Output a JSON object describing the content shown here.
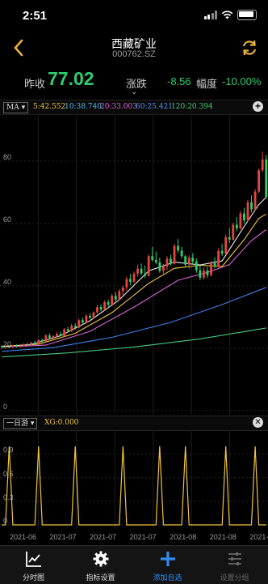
{
  "status": {
    "time": "2:51"
  },
  "header": {
    "name": "西藏矿业",
    "code": "000762.SZ"
  },
  "quote": {
    "prev_close_label": "昨收",
    "prev_close": "77.02",
    "change_label": "涨跌",
    "change": "-8.56",
    "pct_label": "幅度",
    "pct": "-10.00%"
  },
  "ma_bar": {
    "selector": "MA",
    "ma5": "5:42.552",
    "ma10": "10:38.740",
    "ma20": "20:33.003",
    "ma60": "60:25.421",
    "ma120": "120:20.394"
  },
  "xg_bar": {
    "selector": "一日游",
    "value": "XG:0.000"
  },
  "tabs": [
    {
      "label": "分时图",
      "icon": "line-chart-icon"
    },
    {
      "label": "指标设置",
      "icon": "gear-icon"
    },
    {
      "label": "添加自选",
      "icon": "plus-icon"
    },
    {
      "label": "设置分组",
      "icon": "sliders-icon"
    }
  ],
  "colors": {
    "up": "#e8443a",
    "down": "#2fcd72",
    "ma5": "#e6e6e6",
    "ma10": "#f0c53a",
    "ma20": "#d865d2",
    "ma60": "#3f7fe6",
    "ma120": "#46c87a",
    "accent": "#e8b339"
  },
  "chart_data": [
    {
      "type": "candlestick",
      "y_ticks": [
        "80",
        "60",
        "40",
        "20",
        "0"
      ],
      "ylim": [
        0,
        95
      ],
      "x_tick_labels": [
        "2021-06",
        "2021-07",
        "2021-07",
        "2021-07",
        "2021-08",
        "2021-08",
        "2021-0"
      ],
      "candles": [
        [
          20.6,
          21.0,
          19.9,
          20.3
        ],
        [
          20.3,
          20.8,
          19.8,
          20.5
        ],
        [
          20.5,
          20.9,
          20.1,
          20.4
        ],
        [
          20.4,
          21.1,
          20.0,
          20.9
        ],
        [
          20.9,
          21.2,
          20.3,
          20.6
        ],
        [
          20.6,
          21.0,
          20.2,
          20.8
        ],
        [
          20.8,
          21.6,
          20.5,
          21.3
        ],
        [
          21.3,
          21.8,
          20.9,
          21.1
        ],
        [
          21.1,
          22.0,
          20.8,
          21.8
        ],
        [
          21.8,
          22.4,
          21.2,
          21.4
        ],
        [
          21.4,
          22.9,
          21.1,
          22.6
        ],
        [
          22.6,
          23.2,
          21.9,
          22.2
        ],
        [
          22.2,
          24.5,
          22.0,
          24.1
        ],
        [
          24.1,
          24.8,
          23.0,
          23.3
        ],
        [
          23.3,
          24.2,
          22.8,
          23.9
        ],
        [
          23.9,
          25.1,
          23.4,
          24.6
        ],
        [
          24.6,
          25.2,
          23.8,
          24.0
        ],
        [
          24.0,
          26.5,
          23.8,
          26.1
        ],
        [
          26.1,
          26.9,
          25.1,
          25.5
        ],
        [
          25.5,
          27.8,
          25.2,
          27.2
        ],
        [
          27.2,
          28.0,
          26.0,
          26.6
        ],
        [
          26.6,
          29.5,
          26.4,
          29.0
        ],
        [
          29.0,
          29.8,
          27.9,
          28.2
        ],
        [
          28.2,
          30.9,
          27.9,
          30.4
        ],
        [
          30.4,
          31.2,
          29.3,
          29.8
        ],
        [
          29.8,
          31.8,
          29.4,
          31.5
        ],
        [
          31.5,
          33.9,
          31.0,
          33.2
        ],
        [
          33.2,
          34.1,
          31.8,
          32.4
        ],
        [
          32.4,
          35.3,
          32.1,
          34.8
        ],
        [
          34.8,
          35.6,
          33.2,
          33.9
        ],
        [
          33.9,
          37.4,
          33.5,
          36.8
        ],
        [
          36.8,
          38.0,
          35.0,
          35.6
        ],
        [
          35.6,
          39.0,
          35.3,
          38.3
        ],
        [
          38.3,
          40.1,
          36.8,
          39.5
        ],
        [
          39.5,
          43.0,
          38.5,
          42.2
        ],
        [
          42.2,
          43.8,
          40.2,
          41.3
        ],
        [
          41.3,
          44.6,
          40.9,
          43.9
        ],
        [
          43.9,
          46.8,
          43.0,
          45.5
        ],
        [
          45.5,
          47.2,
          43.4,
          44.0
        ],
        [
          44.0,
          46.5,
          42.5,
          43.2
        ],
        [
          43.2,
          50.1,
          43.0,
          49.5
        ],
        [
          49.5,
          52.5,
          47.8,
          48.3
        ],
        [
          48.3,
          51.0,
          46.9,
          47.5
        ],
        [
          47.5,
          49.0,
          44.2,
          44.8
        ],
        [
          44.8,
          47.0,
          43.5,
          46.2
        ],
        [
          46.2,
          49.5,
          45.0,
          48.7
        ],
        [
          48.7,
          50.0,
          46.5,
          47.1
        ],
        [
          47.1,
          53.5,
          46.8,
          52.8
        ],
        [
          52.8,
          55.0,
          50.5,
          51.3
        ],
        [
          51.3,
          52.5,
          48.8,
          49.5
        ],
        [
          49.5,
          50.0,
          46.0,
          46.8
        ],
        [
          46.8,
          49.8,
          45.5,
          49.0
        ],
        [
          49.0,
          50.5,
          47.0,
          47.8
        ],
        [
          47.8,
          48.8,
          44.2,
          45.0
        ],
        [
          45.0,
          46.5,
          41.8,
          42.6
        ],
        [
          42.6,
          45.8,
          42.0,
          44.9
        ],
        [
          44.9,
          46.0,
          42.5,
          43.4
        ],
        [
          43.4,
          48.0,
          43.0,
          47.3
        ],
        [
          47.3,
          49.2,
          45.6,
          46.2
        ],
        [
          46.2,
          52.0,
          45.9,
          51.2
        ],
        [
          51.2,
          53.5,
          49.6,
          50.3
        ],
        [
          50.3,
          56.5,
          50.0,
          55.6
        ],
        [
          55.6,
          58.5,
          53.8,
          54.8
        ],
        [
          54.8,
          60.3,
          54.5,
          59.6
        ],
        [
          59.6,
          62.0,
          57.5,
          58.4
        ],
        [
          58.4,
          64.0,
          58.0,
          63.2
        ],
        [
          63.2,
          65.0,
          60.0,
          61.0
        ],
        [
          61.0,
          67.5,
          60.6,
          66.8
        ],
        [
          66.8,
          69.0,
          63.5,
          64.5
        ],
        [
          64.5,
          71.0,
          64.2,
          70.2
        ],
        [
          70.2,
          77.5,
          69.8,
          77.02
        ],
        [
          77.02,
          83.0,
          76.5,
          80.5
        ],
        [
          80.5,
          82.0,
          68.0,
          68.46
        ]
      ],
      "ma": {
        "ma5": [
          [
            0,
            20.5
          ],
          [
            8,
            21.2
          ],
          [
            16,
            24.0
          ],
          [
            24,
            28.8
          ],
          [
            32,
            35.5
          ],
          [
            40,
            44.8
          ],
          [
            47,
            47.6
          ],
          [
            54,
            46.7
          ],
          [
            60,
            48.0
          ],
          [
            66,
            59.0
          ],
          [
            70,
            66.0
          ],
          [
            72,
            68.4
          ]
        ],
        "ma10": [
          [
            0,
            20.6
          ],
          [
            10,
            21.3
          ],
          [
            20,
            24.8
          ],
          [
            30,
            31.4
          ],
          [
            40,
            40.8
          ],
          [
            47,
            45.6
          ],
          [
            54,
            46.6
          ],
          [
            60,
            46.2
          ],
          [
            66,
            54.8
          ],
          [
            70,
            61.6
          ],
          [
            72,
            63.0
          ]
        ],
        "ma20": [
          [
            0,
            20.4
          ],
          [
            12,
            21.0
          ],
          [
            24,
            25.4
          ],
          [
            36,
            33.2
          ],
          [
            48,
            41.8
          ],
          [
            56,
            44.3
          ],
          [
            62,
            46.8
          ],
          [
            68,
            54.5
          ],
          [
            72,
            58.0
          ]
        ],
        "ma60": [
          [
            0,
            19.0
          ],
          [
            14,
            20.2
          ],
          [
            30,
            23.5
          ],
          [
            46,
            28.3
          ],
          [
            60,
            34.0
          ],
          [
            72,
            39.5
          ]
        ],
        "ma120": [
          [
            0,
            17.2
          ],
          [
            18,
            18.5
          ],
          [
            36,
            20.4
          ],
          [
            54,
            23.0
          ],
          [
            72,
            26.5
          ]
        ]
      }
    },
    {
      "type": "line",
      "name": "XG",
      "y_ticks": [
        "0.9",
        "0.6",
        "0.3",
        "0"
      ],
      "ylim": [
        0,
        1
      ],
      "spikes_at": [
        2,
        10,
        20,
        33,
        43,
        50,
        61,
        69
      ]
    }
  ]
}
